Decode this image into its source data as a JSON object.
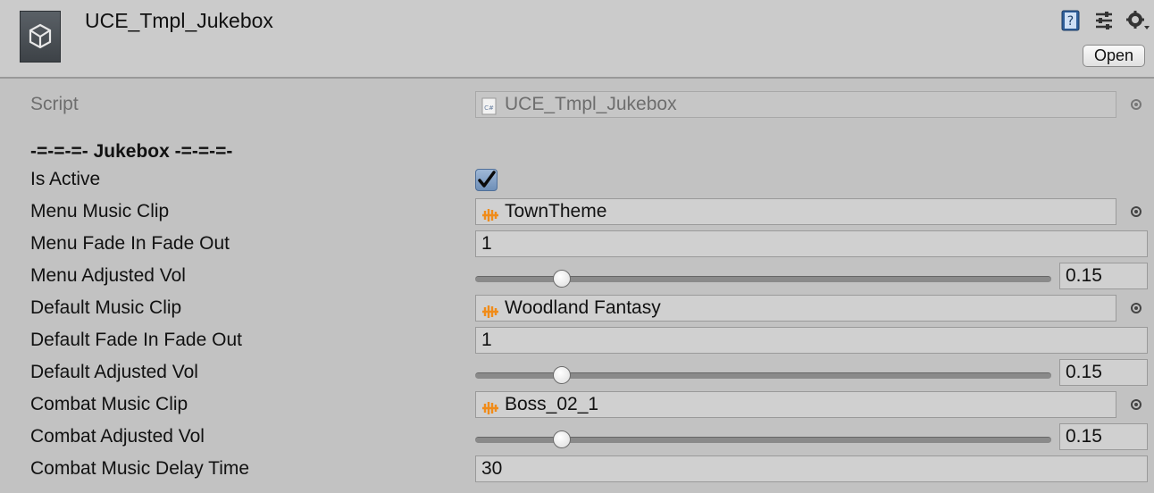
{
  "header": {
    "title": "UCE_Tmpl_Jukebox",
    "open_label": "Open",
    "icons": [
      "unity-logo-icon",
      "help-book-icon",
      "preset-sliders-icon",
      "gear-menu-icon"
    ]
  },
  "script_row": {
    "label": "Script",
    "value": "UCE_Tmpl_Jukebox"
  },
  "section_header": "-=-=-=- Jukebox -=-=-=-",
  "fields": {
    "is_active": {
      "label": "Is Active",
      "checked": true
    },
    "menu_music_clip": {
      "label": "Menu Music Clip",
      "value": "TownTheme"
    },
    "menu_fade": {
      "label": "Menu Fade In Fade Out",
      "value": "1"
    },
    "menu_vol": {
      "label": "Menu Adjusted Vol",
      "value": "0.15",
      "level": 0.15
    },
    "default_music_clip": {
      "label": "Default Music Clip",
      "value": "Woodland Fantasy"
    },
    "default_fade": {
      "label": "Default Fade In Fade Out",
      "value": "1"
    },
    "default_vol": {
      "label": "Default Adjusted Vol",
      "value": "0.15",
      "level": 0.15
    },
    "combat_music_clip": {
      "label": "Combat Music Clip",
      "value": "Boss_02_1"
    },
    "combat_vol": {
      "label": "Combat Adjusted Vol",
      "value": "0.15",
      "level": 0.15
    },
    "combat_delay": {
      "label": "Combat Music Delay Time",
      "value": "30"
    }
  },
  "colors": {
    "checkbox_fill": "#7f9cc4",
    "clip_icon": "#f08c1a"
  }
}
